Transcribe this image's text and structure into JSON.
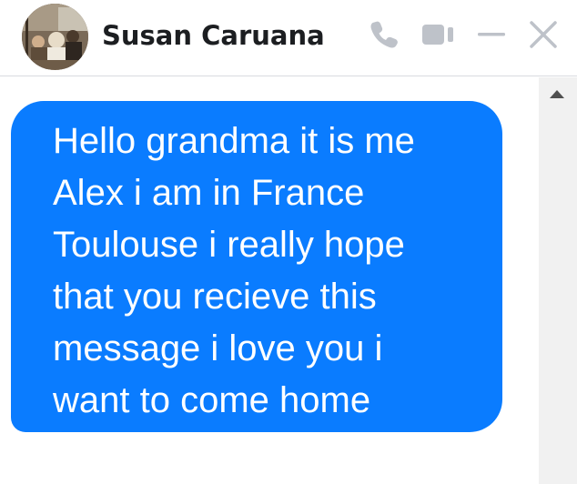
{
  "header": {
    "contact_name": "Susan Caruana",
    "avatar_icon": "profile-photo",
    "actions": [
      {
        "name": "phone-icon"
      },
      {
        "name": "video-camera-icon"
      },
      {
        "name": "minimize-icon"
      },
      {
        "name": "close-icon"
      }
    ]
  },
  "conversation": {
    "messages": [
      {
        "sender": "self",
        "text": "Hello grandma it is me\nAlex i am in France\nToulouse i really hope\nthat you recieve this\nmessage i love you i\nwant to come home"
      }
    ]
  },
  "colors": {
    "bubble": "#0a7cff",
    "icon": "#bec2c9",
    "name": "#1c1e21"
  }
}
